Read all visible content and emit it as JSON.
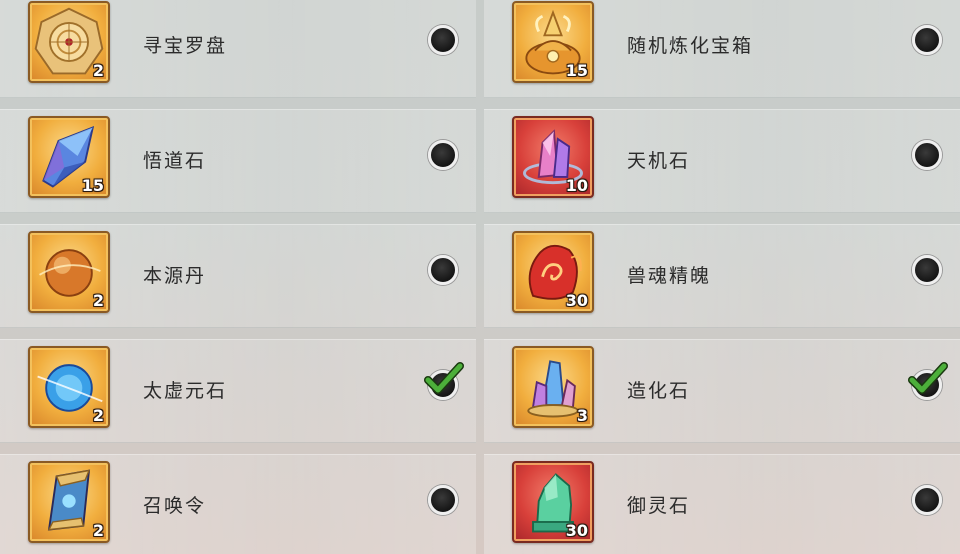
{
  "items": [
    {
      "name": "寻宝罗盘",
      "count": "2",
      "frame": "gold",
      "icon": "compass-icon",
      "selected": false
    },
    {
      "name": "随机炼化宝箱",
      "count": "15",
      "frame": "gold",
      "icon": "treasure-bag-icon",
      "selected": false
    },
    {
      "name": "悟道石",
      "count": "15",
      "frame": "gold",
      "icon": "blue-crystal-icon",
      "selected": false
    },
    {
      "name": "天机石",
      "count": "10",
      "frame": "red",
      "icon": "pink-crystal-icon",
      "selected": false
    },
    {
      "name": "本源丹",
      "count": "2",
      "frame": "gold",
      "icon": "amber-orb-icon",
      "selected": false
    },
    {
      "name": "兽魂精魄",
      "count": "30",
      "frame": "gold",
      "icon": "flame-spirit-icon",
      "selected": false
    },
    {
      "name": "太虚元石",
      "count": "2",
      "frame": "gold",
      "icon": "blue-orb-icon",
      "selected": true
    },
    {
      "name": "造化石",
      "count": "3",
      "frame": "gold",
      "icon": "crystal-cluster-icon",
      "selected": true
    },
    {
      "name": "召唤令",
      "count": "2",
      "frame": "gold",
      "icon": "summon-token-icon",
      "selected": false
    },
    {
      "name": "御灵石",
      "count": "30",
      "frame": "red",
      "icon": "jade-stone-icon",
      "selected": false
    }
  ],
  "colors": {
    "check": "#4caf3a",
    "radio_fill": "#1a1a1a",
    "gold_frame": "#f1ae3e",
    "red_frame": "#d8403a"
  }
}
